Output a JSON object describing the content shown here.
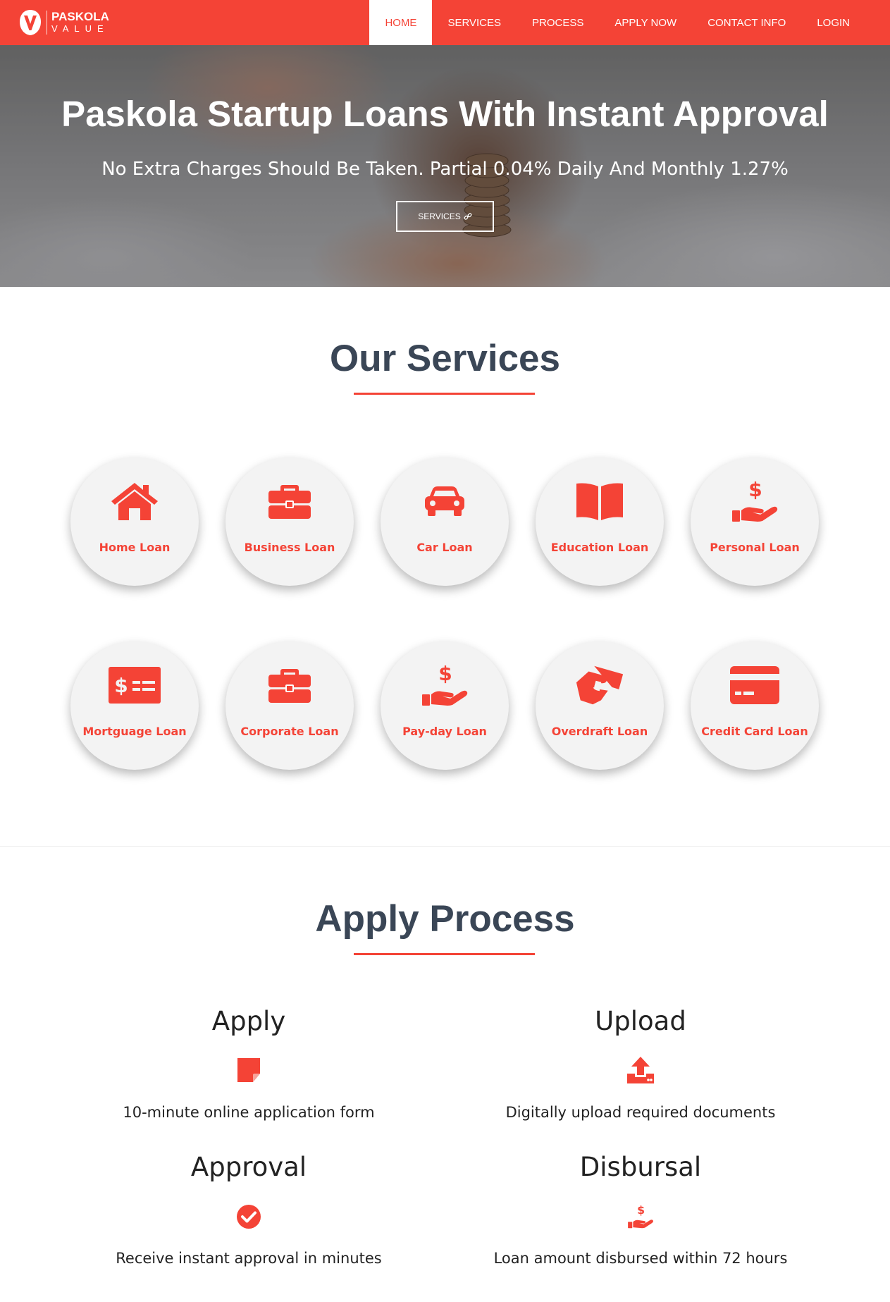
{
  "brand": {
    "name": "PASKOLA",
    "sub": "VALUE"
  },
  "nav": {
    "items": [
      {
        "label": "HOME",
        "active": true
      },
      {
        "label": "SERVICES"
      },
      {
        "label": "PROCESS"
      },
      {
        "label": "APPLY NOW"
      },
      {
        "label": "CONTACT INFO"
      },
      {
        "label": "LOGIN"
      }
    ]
  },
  "hero": {
    "title": "Paskola Startup Loans With Instant Approval",
    "subtitle": "No Extra Charges Should Be Taken. Partial 0.04% Daily And Monthly 1.27%",
    "button_label": "SERVICES"
  },
  "services": {
    "title": "Our Services",
    "items": [
      {
        "label": "Home Loan",
        "icon": "home-icon"
      },
      {
        "label": "Business Loan",
        "icon": "briefcase-icon"
      },
      {
        "label": "Car Loan",
        "icon": "car-icon"
      },
      {
        "label": "Education Loan",
        "icon": "book-icon"
      },
      {
        "label": "Personal Loan",
        "icon": "hand-dollar-icon"
      },
      {
        "label": "Mortguage Loan",
        "icon": "money-check-icon"
      },
      {
        "label": "Corporate Loan",
        "icon": "briefcase-icon"
      },
      {
        "label": "Pay-day Loan",
        "icon": "hand-dollar-icon"
      },
      {
        "label": "Overdraft Loan",
        "icon": "handshake-icon"
      },
      {
        "label": "Credit Card Loan",
        "icon": "credit-card-icon"
      }
    ]
  },
  "process": {
    "title": "Apply Process",
    "steps": [
      {
        "title": "Apply",
        "description": "10-minute online application form",
        "icon": "sticky-note-icon"
      },
      {
        "title": "Upload",
        "description": "Digitally upload required documents",
        "icon": "upload-icon"
      },
      {
        "title": "Approval",
        "description": "Receive instant approval in minutes",
        "icon": "check-circle-icon"
      },
      {
        "title": "Disbursal",
        "description": "Loan amount disbursed within 72 hours",
        "icon": "hand-dollar-icon"
      }
    ]
  },
  "colors": {
    "accent": "#f44336",
    "heading": "#3a4656",
    "circle_bg": "#f3f3f3"
  }
}
